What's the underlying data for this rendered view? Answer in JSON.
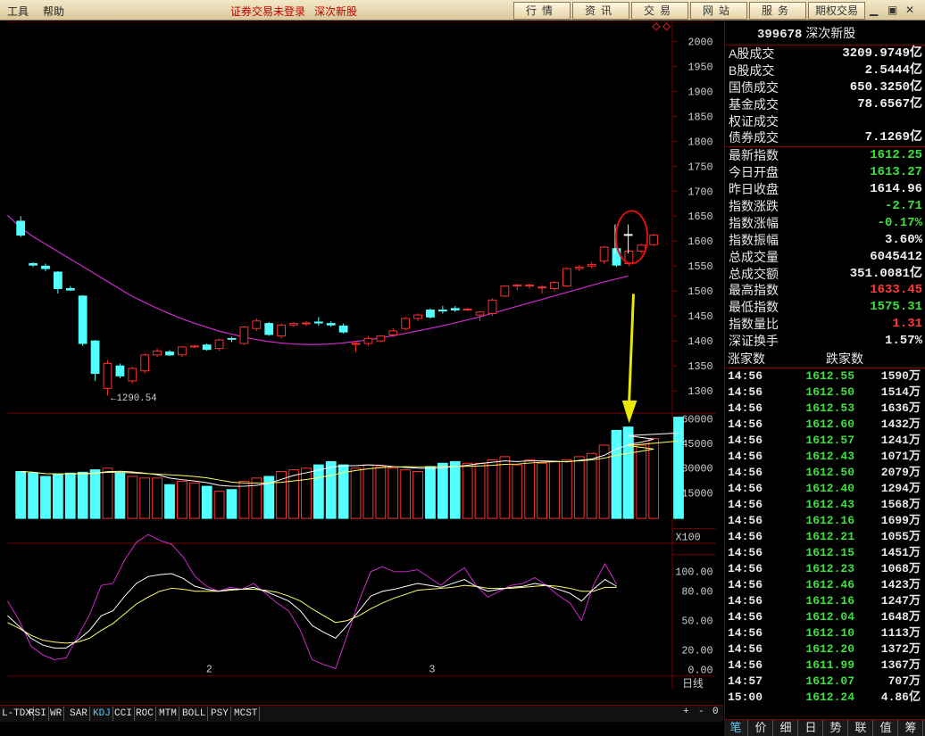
{
  "menu": {
    "items": [
      "工具",
      "帮助"
    ],
    "status": "证券交易未登录",
    "security_name": "深次新股",
    "buttons": [
      "行情",
      "资讯",
      "交易",
      "网站",
      "服务",
      "期权交易"
    ]
  },
  "colors": {
    "up": "#ff3232",
    "down": "#54ffff",
    "ma": "#d12bd1",
    "white": "#ffffff",
    "yellow": "#ffff66",
    "green": "#3ee03e",
    "grid": "#7a0000"
  },
  "price_axis": [
    "2000",
    "1950",
    "1900",
    "1850",
    "1800",
    "1750",
    "1700",
    "1650",
    "1600",
    "1550",
    "1500",
    "1450",
    "1400",
    "1350",
    "1300"
  ],
  "volume_axis": [
    "60000",
    "45000",
    "30000",
    "15000",
    "X100"
  ],
  "kdj_axis": [
    "100.00",
    "80.00",
    "50.00",
    "20.00",
    "0.00"
  ],
  "low_marker": "1290.54",
  "date_labels": [
    "2",
    "3"
  ],
  "period_label": "日线",
  "zoom_controls": [
    "+",
    "-",
    "0"
  ],
  "indicator_tabs": [
    "L-TDX",
    "RSI",
    "WR",
    "SAR",
    "KDJ",
    "CCI",
    "ROC",
    "MTM",
    "BOLL",
    "PSY",
    "MCST"
  ],
  "active_indicator": "KDJ",
  "chart_data": {
    "type": "candlestick",
    "candles": [
      {
        "o": 1640,
        "h": 1650,
        "l": 1608,
        "c": 1612
      },
      {
        "o": 1555,
        "h": 1558,
        "l": 1548,
        "c": 1552
      },
      {
        "o": 1550,
        "h": 1555,
        "l": 1540,
        "c": 1545
      },
      {
        "o": 1538,
        "h": 1540,
        "l": 1495,
        "c": 1505
      },
      {
        "o": 1505,
        "h": 1510,
        "l": 1500,
        "c": 1502
      },
      {
        "o": 1490,
        "h": 1492,
        "l": 1390,
        "c": 1395
      },
      {
        "o": 1400,
        "h": 1402,
        "l": 1320,
        "c": 1335
      },
      {
        "o": 1305,
        "h": 1362,
        "l": 1290.54,
        "c": 1355
      },
      {
        "o": 1350,
        "h": 1355,
        "l": 1325,
        "c": 1330
      },
      {
        "o": 1320,
        "h": 1348,
        "l": 1315,
        "c": 1345
      },
      {
        "o": 1340,
        "h": 1375,
        "l": 1335,
        "c": 1372
      },
      {
        "o": 1372,
        "h": 1385,
        "l": 1368,
        "c": 1380
      },
      {
        "o": 1378,
        "h": 1382,
        "l": 1370,
        "c": 1372
      },
      {
        "o": 1372,
        "h": 1390,
        "l": 1368,
        "c": 1388
      },
      {
        "o": 1388,
        "h": 1392,
        "l": 1385,
        "c": 1390
      },
      {
        "o": 1392,
        "h": 1395,
        "l": 1380,
        "c": 1383
      },
      {
        "o": 1385,
        "h": 1405,
        "l": 1380,
        "c": 1402
      },
      {
        "o": 1405,
        "h": 1408,
        "l": 1398,
        "c": 1404
      },
      {
        "o": 1395,
        "h": 1430,
        "l": 1392,
        "c": 1428
      },
      {
        "o": 1425,
        "h": 1445,
        "l": 1420,
        "c": 1440
      },
      {
        "o": 1435,
        "h": 1438,
        "l": 1410,
        "c": 1413
      },
      {
        "o": 1410,
        "h": 1435,
        "l": 1405,
        "c": 1432
      },
      {
        "o": 1432,
        "h": 1438,
        "l": 1428,
        "c": 1435
      },
      {
        "o": 1435,
        "h": 1440,
        "l": 1430,
        "c": 1436
      },
      {
        "o": 1438,
        "h": 1448,
        "l": 1430,
        "c": 1436
      },
      {
        "o": 1435,
        "h": 1440,
        "l": 1428,
        "c": 1432
      },
      {
        "o": 1430,
        "h": 1435,
        "l": 1415,
        "c": 1418
      },
      {
        "o": 1395,
        "h": 1400,
        "l": 1378,
        "c": 1395
      },
      {
        "o": 1395,
        "h": 1410,
        "l": 1390,
        "c": 1405
      },
      {
        "o": 1400,
        "h": 1412,
        "l": 1398,
        "c": 1410
      },
      {
        "o": 1412,
        "h": 1425,
        "l": 1408,
        "c": 1420
      },
      {
        "o": 1425,
        "h": 1448,
        "l": 1420,
        "c": 1445
      },
      {
        "o": 1445,
        "h": 1455,
        "l": 1440,
        "c": 1452
      },
      {
        "o": 1462,
        "h": 1465,
        "l": 1445,
        "c": 1448
      },
      {
        "o": 1462,
        "h": 1470,
        "l": 1455,
        "c": 1460
      },
      {
        "o": 1465,
        "h": 1470,
        "l": 1458,
        "c": 1462
      },
      {
        "o": 1462,
        "h": 1466,
        "l": 1460,
        "c": 1464
      },
      {
        "o": 1452,
        "h": 1460,
        "l": 1440,
        "c": 1458
      },
      {
        "o": 1455,
        "h": 1485,
        "l": 1450,
        "c": 1482
      },
      {
        "o": 1490,
        "h": 1512,
        "l": 1488,
        "c": 1510
      },
      {
        "o": 1510,
        "h": 1515,
        "l": 1502,
        "c": 1512
      },
      {
        "o": 1510,
        "h": 1515,
        "l": 1505,
        "c": 1512
      },
      {
        "o": 1508,
        "h": 1512,
        "l": 1495,
        "c": 1508
      },
      {
        "o": 1505,
        "h": 1520,
        "l": 1500,
        "c": 1517
      },
      {
        "o": 1510,
        "h": 1548,
        "l": 1508,
        "c": 1545
      },
      {
        "o": 1545,
        "h": 1552,
        "l": 1540,
        "c": 1548
      },
      {
        "o": 1550,
        "h": 1558,
        "l": 1545,
        "c": 1553
      },
      {
        "o": 1560,
        "h": 1590,
        "l": 1555,
        "c": 1588
      },
      {
        "o": 1585,
        "h": 1590,
        "l": 1548,
        "c": 1552
      },
      {
        "o": 1555,
        "h": 1582,
        "l": 1550,
        "c": 1580
      },
      {
        "o": 1580,
        "h": 1595,
        "l": 1575,
        "c": 1592
      },
      {
        "o": 1593,
        "h": 1615,
        "l": 1590,
        "c": 1612
      },
      {
        "o": 1613.27,
        "h": 1633.45,
        "l": 1575.31,
        "c": 1612.25
      }
    ],
    "ma": [
      1652,
      1628,
      1610,
      1595,
      1580,
      1565,
      1550,
      1535,
      1520,
      1505,
      1490,
      1478,
      1466,
      1455,
      1445,
      1436,
      1428,
      1420,
      1414,
      1408,
      1403,
      1399,
      1396,
      1394,
      1393,
      1393,
      1394,
      1396,
      1399,
      1402,
      1406,
      1410,
      1415,
      1420,
      1425,
      1430,
      1436,
      1442,
      1448,
      1455,
      1462,
      1469,
      1476,
      1483,
      1490,
      1497,
      1504,
      1511,
      1518,
      1524,
      1530
    ],
    "volumes": [
      28000,
      27000,
      25000,
      26000,
      27000,
      27500,
      29000,
      30000,
      27000,
      25000,
      24000,
      24000,
      20000,
      22000,
      21000,
      19000,
      16000,
      17000,
      22000,
      24000,
      25000,
      28000,
      29000,
      30000,
      32000,
      34000,
      32000,
      30000,
      32000,
      31000,
      30000,
      29000,
      28000,
      31000,
      33000,
      34000,
      33000,
      33000,
      35000,
      37000,
      32000,
      35000,
      33000,
      34000,
      35000,
      37000,
      39000,
      44000,
      53000,
      49000,
      44000,
      48000,
      55000,
      61000
    ],
    "kdj_k": [
      55,
      44,
      32,
      25,
      22,
      22,
      30,
      40,
      55,
      60,
      75,
      88,
      95,
      97,
      98,
      93,
      85,
      82,
      80,
      82,
      82,
      84,
      80,
      75,
      70,
      60,
      45,
      38,
      32,
      45,
      60,
      75,
      80,
      82,
      85,
      88,
      86,
      84,
      88,
      92,
      85,
      80,
      82,
      84,
      85,
      88,
      86,
      82,
      78,
      70,
      82,
      92,
      85
    ],
    "kdj_d": [
      48,
      42,
      35,
      30,
      28,
      27,
      28,
      32,
      40,
      47,
      57,
      67,
      74,
      80,
      83,
      82,
      80,
      80,
      80,
      81,
      82,
      82,
      81,
      79,
      75,
      70,
      62,
      55,
      48,
      50,
      55,
      62,
      68,
      73,
      77,
      81,
      82,
      83,
      84,
      86,
      85,
      83,
      83,
      83,
      84,
      85,
      86,
      85,
      83,
      80,
      80,
      84,
      84
    ],
    "kdj_j": [
      70,
      50,
      24,
      15,
      10,
      12,
      34,
      56,
      86,
      88,
      112,
      130,
      138,
      132,
      128,
      115,
      95,
      85,
      80,
      84,
      82,
      88,
      78,
      68,
      60,
      40,
      10,
      5,
      1,
      35,
      70,
      100,
      105,
      100,
      100,
      102,
      94,
      86,
      96,
      104,
      86,
      74,
      80,
      86,
      88,
      94,
      86,
      76,
      68,
      50,
      86,
      108,
      87
    ]
  },
  "right_panel": {
    "code": "399678",
    "name": "深次新股",
    "turnover": [
      {
        "k": "A股成交",
        "v": "3209.9749亿"
      },
      {
        "k": "B股成交",
        "v": "2.5444亿"
      },
      {
        "k": "国债成交",
        "v": "650.3250亿"
      },
      {
        "k": "基金成交",
        "v": "78.6567亿"
      },
      {
        "k": "权证成交",
        "v": ""
      },
      {
        "k": "债券成交",
        "v": "7.1269亿"
      }
    ],
    "stats": [
      {
        "k": "最新指数",
        "v": "1612.25",
        "c": "green"
      },
      {
        "k": "今日开盘",
        "v": "1613.27",
        "c": "green"
      },
      {
        "k": "昨日收盘",
        "v": "1614.96",
        "c": "white"
      },
      {
        "k": "指数涨跌",
        "v": "-2.71",
        "c": "green"
      },
      {
        "k": "指数涨幅",
        "v": "-0.17%",
        "c": "green"
      },
      {
        "k": "指数振幅",
        "v": "3.60%",
        "c": "white"
      },
      {
        "k": "总成交量",
        "v": "6045412",
        "c": "white"
      },
      {
        "k": "总成交额",
        "v": "351.0081亿",
        "c": "white"
      },
      {
        "k": "最高指数",
        "v": "1633.45",
        "c": "red"
      },
      {
        "k": "最低指数",
        "v": "1575.31",
        "c": "green"
      },
      {
        "k": "指数量比",
        "v": "1.31",
        "c": "red"
      },
      {
        "k": "深证换手",
        "v": "1.57%",
        "c": "white"
      }
    ],
    "rise_fall_header": [
      "涨家数",
      "跌家数"
    ],
    "ticks": [
      {
        "t": "14:56",
        "p": "1612.55",
        "v": "1590万"
      },
      {
        "t": "14:56",
        "p": "1612.50",
        "v": "1514万"
      },
      {
        "t": "14:56",
        "p": "1612.53",
        "v": "1636万"
      },
      {
        "t": "14:56",
        "p": "1612.60",
        "v": "1432万"
      },
      {
        "t": "14:56",
        "p": "1612.57",
        "v": "1241万"
      },
      {
        "t": "14:56",
        "p": "1612.43",
        "v": "1071万"
      },
      {
        "t": "14:56",
        "p": "1612.50",
        "v": "2079万"
      },
      {
        "t": "14:56",
        "p": "1612.40",
        "v": "1294万"
      },
      {
        "t": "14:56",
        "p": "1612.43",
        "v": "1568万"
      },
      {
        "t": "14:56",
        "p": "1612.16",
        "v": "1699万"
      },
      {
        "t": "14:56",
        "p": "1612.21",
        "v": "1055万"
      },
      {
        "t": "14:56",
        "p": "1612.15",
        "v": "1451万"
      },
      {
        "t": "14:56",
        "p": "1612.23",
        "v": "1068万"
      },
      {
        "t": "14:56",
        "p": "1612.46",
        "v": "1423万"
      },
      {
        "t": "14:56",
        "p": "1612.16",
        "v": "1247万"
      },
      {
        "t": "14:56",
        "p": "1612.04",
        "v": "1648万"
      },
      {
        "t": "14:56",
        "p": "1612.10",
        "v": "1113万"
      },
      {
        "t": "14:56",
        "p": "1612.20",
        "v": "1372万"
      },
      {
        "t": "14:56",
        "p": "1611.99",
        "v": "1367万"
      },
      {
        "t": "14:57",
        "p": "1612.07",
        "v": "707万"
      },
      {
        "t": "15:00",
        "p": "1612.24",
        "v": "4.86亿"
      }
    ],
    "bottom_tabs": [
      "笔",
      "价",
      "细",
      "日",
      "势",
      "联",
      "值",
      "筹"
    ]
  }
}
